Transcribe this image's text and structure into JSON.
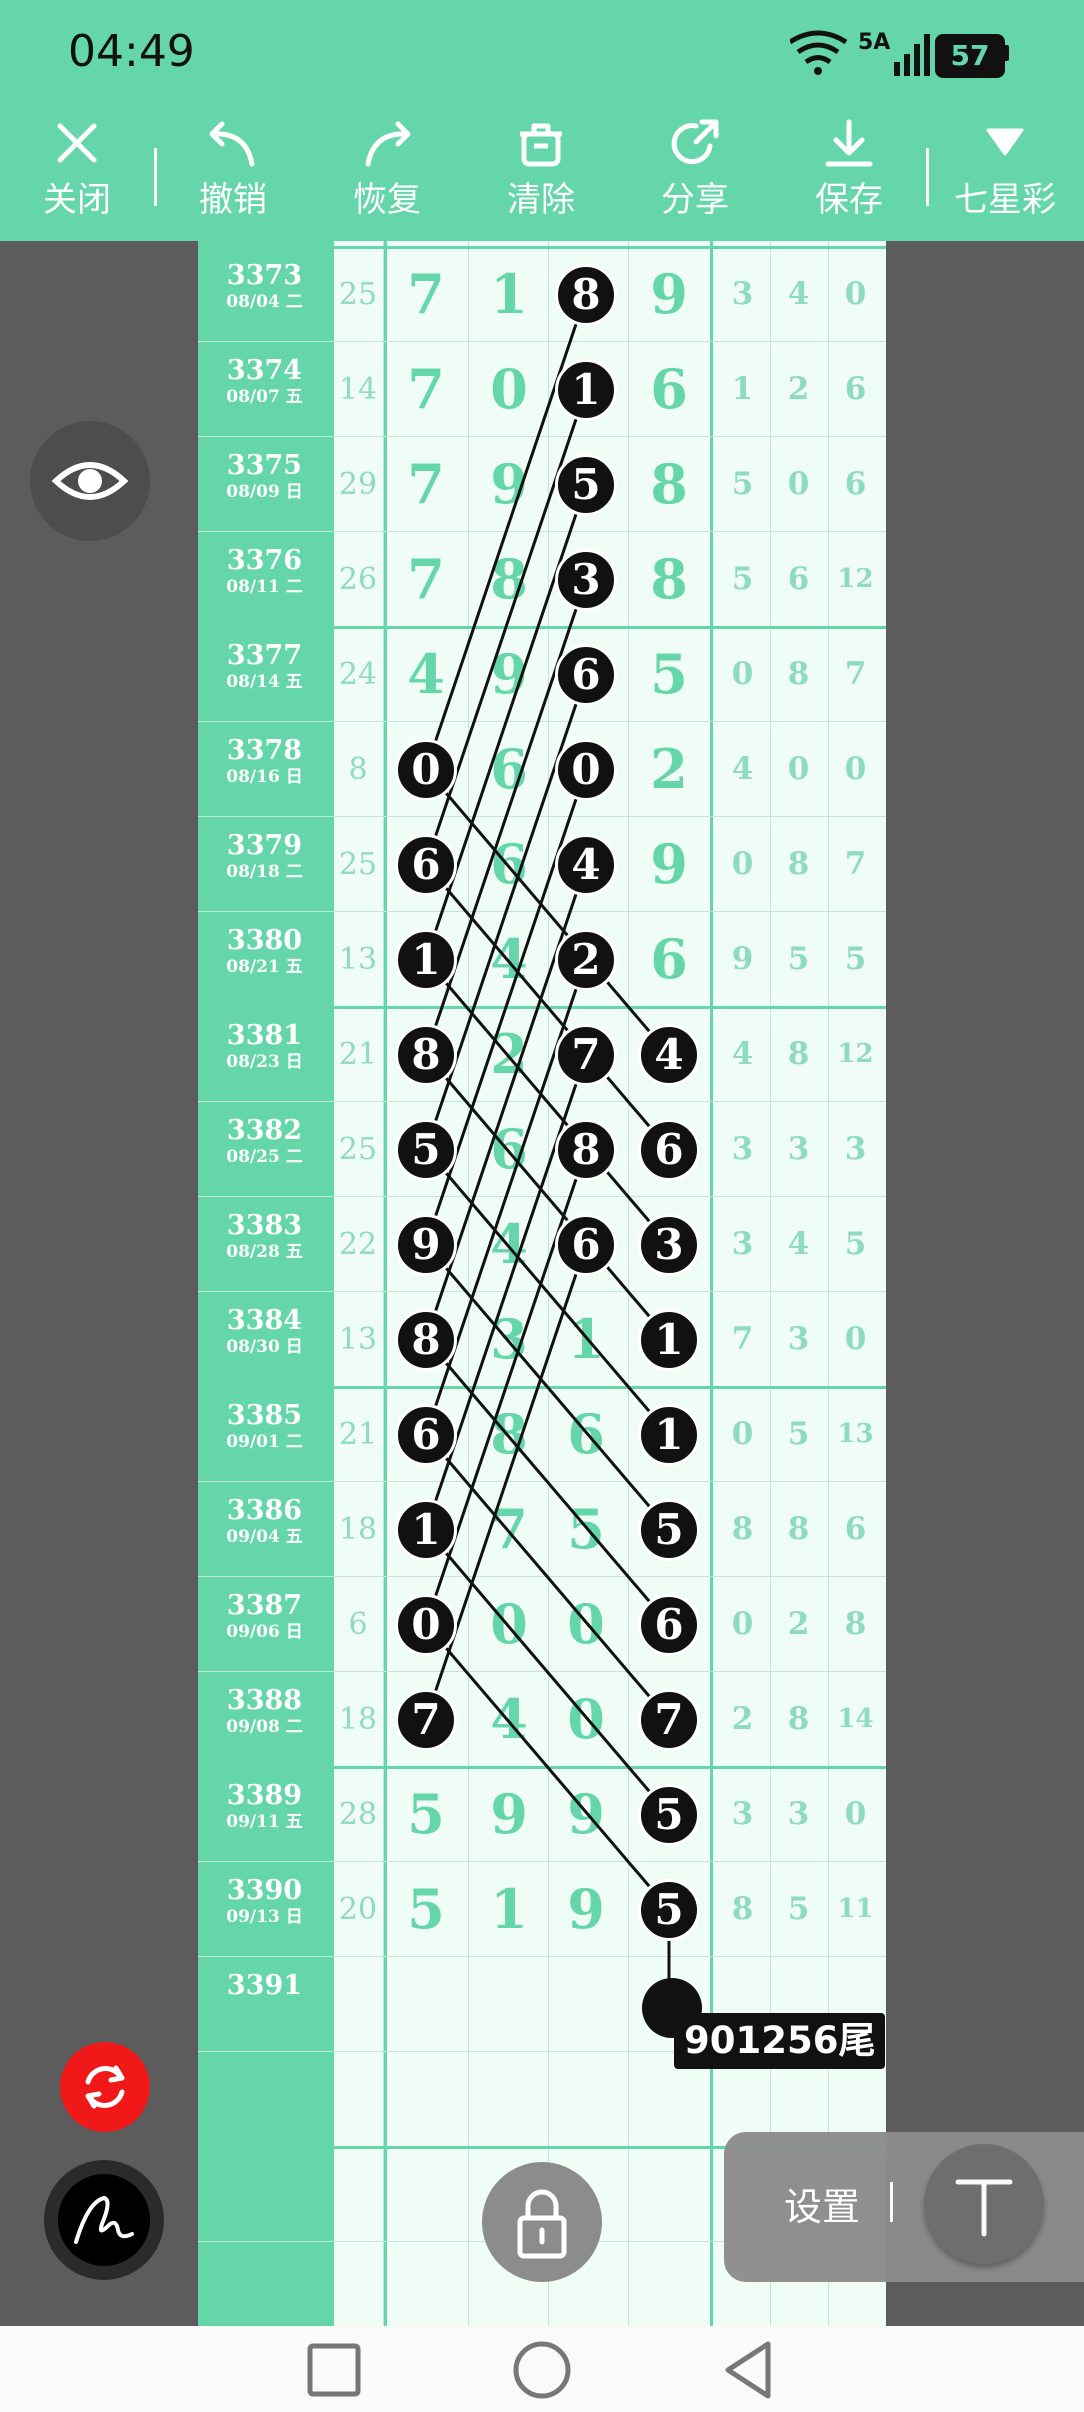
{
  "status_bar": {
    "time": "04:49",
    "network": "5A",
    "battery": "57"
  },
  "toolbar": {
    "close": "关闭",
    "undo": "撤销",
    "redo": "恢复",
    "clear": "清除",
    "share": "分享",
    "save": "保存",
    "lottery": "七星彩"
  },
  "rows": [
    {
      "period": "3373",
      "date": "08/04 二",
      "sum": "25",
      "d": [
        "7",
        "1",
        "8",
        "9"
      ],
      "s": [
        "3",
        "4",
        "0"
      ]
    },
    {
      "period": "3374",
      "date": "08/07 五",
      "sum": "14",
      "d": [
        "7",
        "0",
        "1",
        "6"
      ],
      "s": [
        "1",
        "2",
        "6"
      ]
    },
    {
      "period": "3375",
      "date": "08/09 日",
      "sum": "29",
      "d": [
        "7",
        "9",
        "5",
        "8"
      ],
      "s": [
        "5",
        "0",
        "6"
      ]
    },
    {
      "period": "3376",
      "date": "08/11 二",
      "sum": "26",
      "d": [
        "7",
        "8",
        "3",
        "8"
      ],
      "s": [
        "5",
        "6",
        "12"
      ]
    },
    {
      "period": "3377",
      "date": "08/14 五",
      "sum": "24",
      "d": [
        "4",
        "9",
        "6",
        "5"
      ],
      "s": [
        "0",
        "8",
        "7"
      ]
    },
    {
      "period": "3378",
      "date": "08/16 日",
      "sum": "8",
      "d": [
        "0",
        "6",
        "0",
        "2"
      ],
      "s": [
        "4",
        "0",
        "0"
      ]
    },
    {
      "period": "3379",
      "date": "08/18 二",
      "sum": "25",
      "d": [
        "6",
        "6",
        "4",
        "9"
      ],
      "s": [
        "0",
        "8",
        "7"
      ]
    },
    {
      "period": "3380",
      "date": "08/21 五",
      "sum": "13",
      "d": [
        "1",
        "4",
        "2",
        "6"
      ],
      "s": [
        "9",
        "5",
        "5"
      ]
    },
    {
      "period": "3381",
      "date": "08/23 日",
      "sum": "21",
      "d": [
        "8",
        "2",
        "7",
        "4"
      ],
      "s": [
        "4",
        "8",
        "12"
      ]
    },
    {
      "period": "3382",
      "date": "08/25 二",
      "sum": "25",
      "d": [
        "5",
        "6",
        "8",
        "6"
      ],
      "s": [
        "3",
        "3",
        "3"
      ]
    },
    {
      "period": "3383",
      "date": "08/28 五",
      "sum": "22",
      "d": [
        "9",
        "4",
        "6",
        "3"
      ],
      "s": [
        "3",
        "4",
        "5"
      ]
    },
    {
      "period": "3384",
      "date": "08/30 日",
      "sum": "13",
      "d": [
        "8",
        "3",
        "1",
        "1"
      ],
      "s": [
        "7",
        "3",
        "0"
      ]
    },
    {
      "period": "3385",
      "date": "09/01 二",
      "sum": "21",
      "d": [
        "6",
        "8",
        "6",
        "1"
      ],
      "s": [
        "0",
        "5",
        "13"
      ]
    },
    {
      "period": "3386",
      "date": "09/04 五",
      "sum": "18",
      "d": [
        "1",
        "7",
        "5",
        "5"
      ],
      "s": [
        "8",
        "8",
        "6"
      ]
    },
    {
      "period": "3387",
      "date": "09/06 日",
      "sum": "6",
      "d": [
        "0",
        "0",
        "0",
        "6"
      ],
      "s": [
        "0",
        "2",
        "8"
      ]
    },
    {
      "period": "3388",
      "date": "09/08 二",
      "sum": "18",
      "d": [
        "7",
        "4",
        "0",
        "7"
      ],
      "s": [
        "2",
        "8",
        "14"
      ]
    },
    {
      "period": "3389",
      "date": "09/11 五",
      "sum": "28",
      "d": [
        "5",
        "9",
        "9",
        "5"
      ],
      "s": [
        "3",
        "3",
        "0"
      ]
    },
    {
      "period": "3390",
      "date": "09/13 日",
      "sum": "20",
      "d": [
        "5",
        "1",
        "9",
        "5"
      ],
      "s": [
        "8",
        "5",
        "11"
      ]
    },
    {
      "period": "3391",
      "date": "",
      "sum": "",
      "d": [
        "",
        "",
        "",
        ""
      ],
      "s": [
        "",
        "",
        ""
      ]
    }
  ],
  "highlighted": [
    [
      0,
      2
    ],
    [
      1,
      2
    ],
    [
      2,
      2
    ],
    [
      3,
      2
    ],
    [
      4,
      2
    ],
    [
      5,
      0
    ],
    [
      5,
      2
    ],
    [
      6,
      0
    ],
    [
      6,
      2
    ],
    [
      7,
      0
    ],
    [
      7,
      2
    ],
    [
      8,
      0
    ],
    [
      8,
      2
    ],
    [
      8,
      3
    ],
    [
      9,
      0
    ],
    [
      9,
      2
    ],
    [
      9,
      3
    ],
    [
      10,
      0
    ],
    [
      10,
      2
    ],
    [
      10,
      3
    ],
    [
      11,
      0
    ],
    [
      11,
      3
    ],
    [
      12,
      0
    ],
    [
      12,
      3
    ],
    [
      13,
      0
    ],
    [
      13,
      3
    ],
    [
      14,
      0
    ],
    [
      14,
      3
    ],
    [
      15,
      0
    ],
    [
      15,
      3
    ],
    [
      16,
      3
    ],
    [
      17,
      3
    ]
  ],
  "tail_label": "901256尾",
  "settings": {
    "label": "设置"
  },
  "colors": {
    "accent": "#65d6a9",
    "ball": "#111111",
    "background": "#5c5c5c",
    "refresh": "#f01818"
  }
}
